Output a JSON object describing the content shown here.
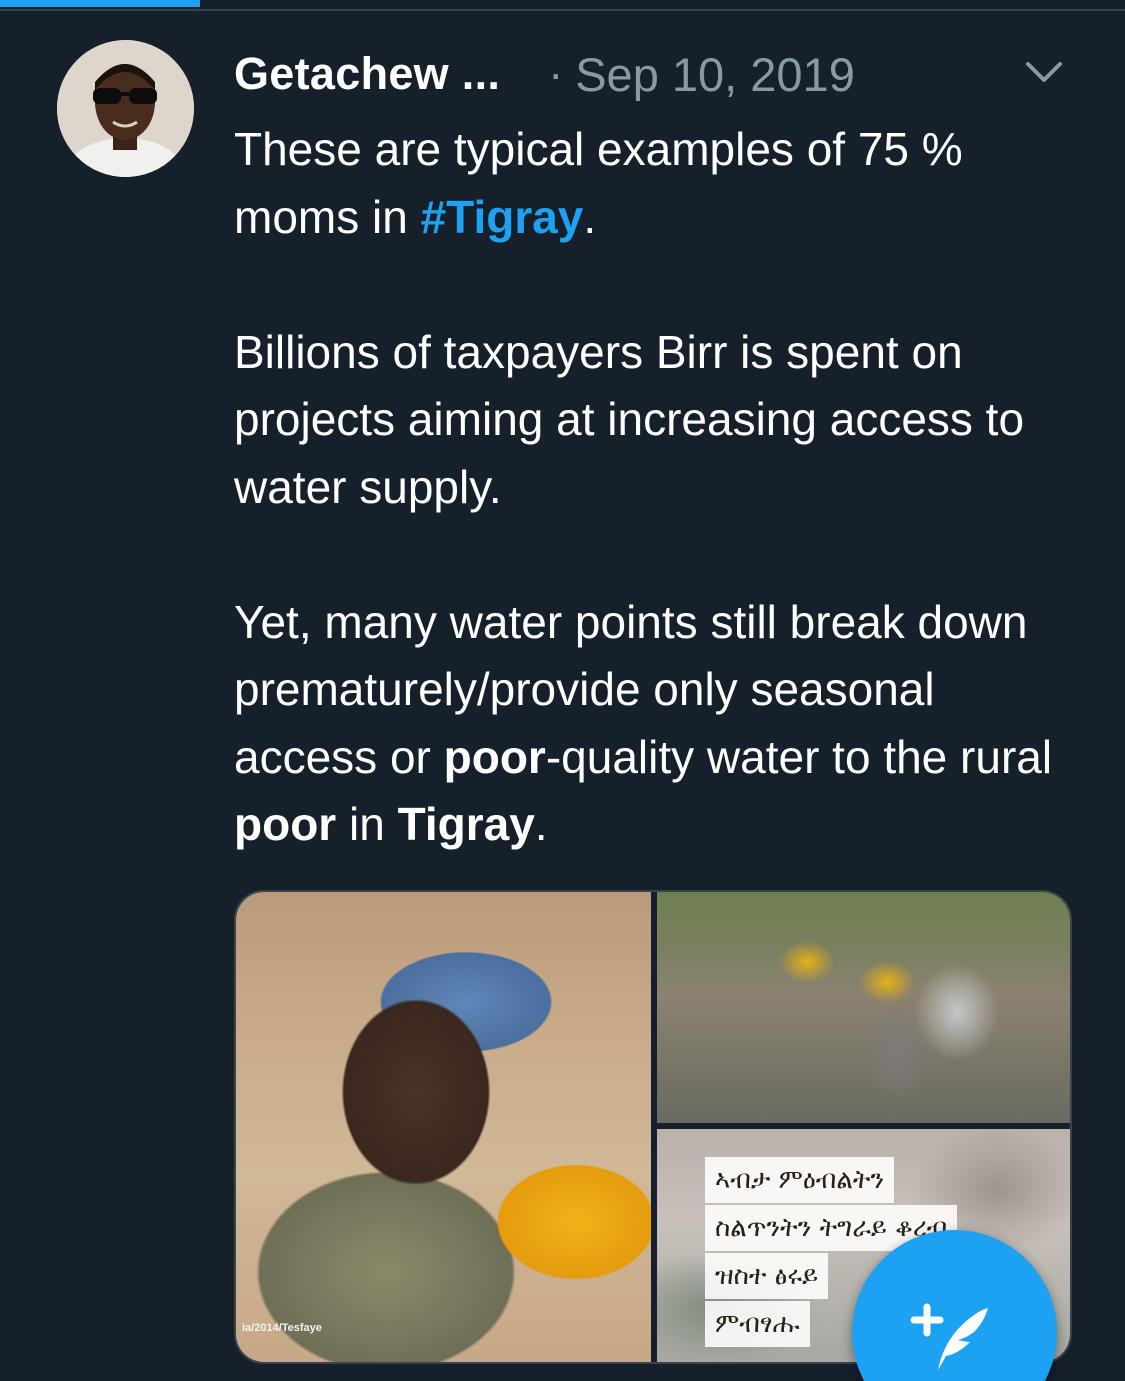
{
  "author": {
    "display_name": "Getachew ...",
    "separator": "·",
    "timestamp": "Sep 10, 2019"
  },
  "tweet": {
    "line1_a": "These are  typical examples of 75 % moms in ",
    "hashtag": "#Tigray",
    "line1_end": ".",
    "para2": "Billions of taxpayers Birr is spent on projects aiming at increasing access to water supply.",
    "para3_a": "Yet, many water points still break down prematurely/provide only seasonal access or ",
    "bold_poor1": "poor",
    "para3_b": "-quality water to the rural ",
    "bold_poor2": "poor",
    "para3_c": " in ",
    "bold_tigray": "Tigray",
    "para3_end": "."
  },
  "media": {
    "watermark": "ia/2014/Tesfaye",
    "amharic_lines": [
      "ኣብታ ምዕብልትን",
      "ስልጥንትን ትግራይ ቆረብ",
      "ዝስተ ፅሩይ",
      "ምብፃሑ"
    ]
  },
  "colors": {
    "background": "#15202b",
    "accent": "#1da1f2",
    "muted": "#8899a6"
  },
  "icons": {
    "more": "chevron-down-icon",
    "compose": "compose-tweet-icon"
  }
}
